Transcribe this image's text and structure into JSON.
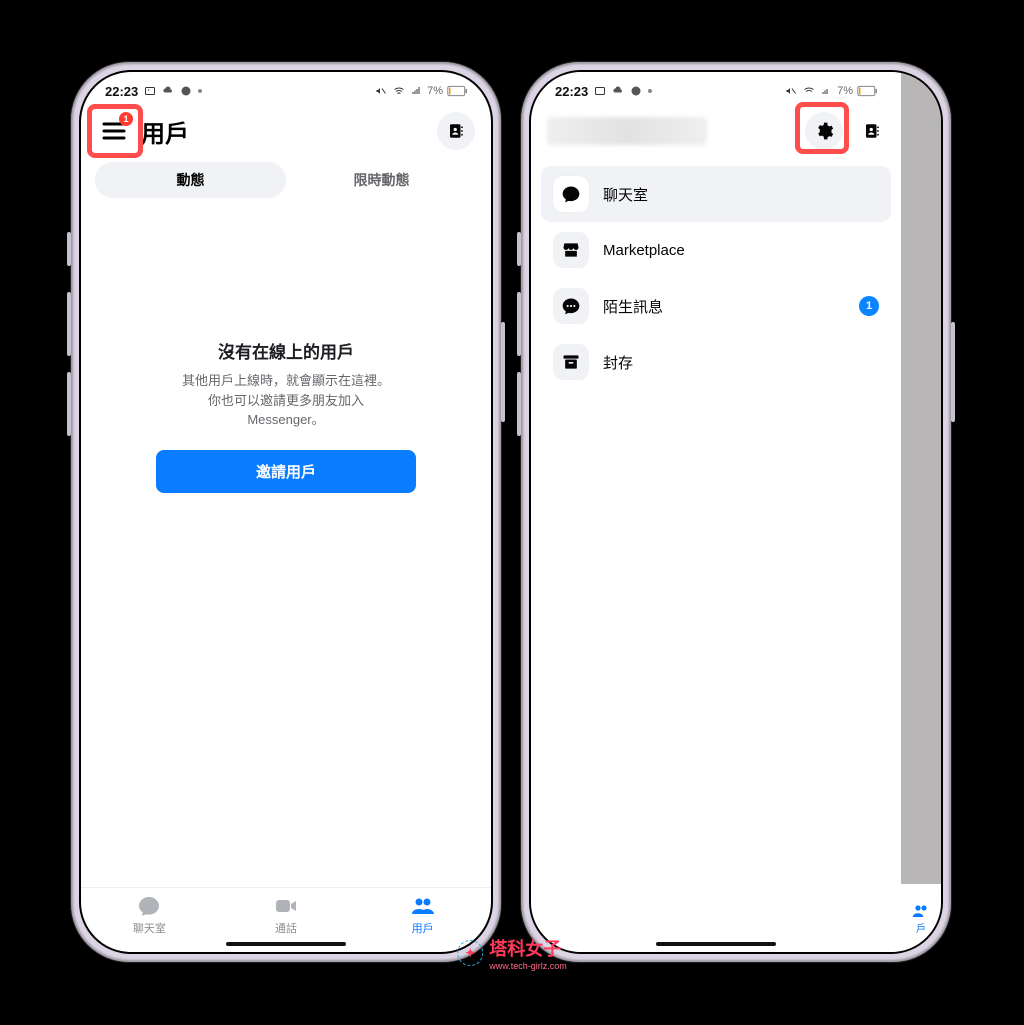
{
  "status": {
    "time": "22:23",
    "battery": "7%"
  },
  "left_phone": {
    "header": {
      "title": "用戶",
      "menu_badge": "1"
    },
    "tabs": {
      "active": "動態",
      "inactive": "限時動態"
    },
    "empty": {
      "title": "沒有在線上的用戶",
      "line1": "其他用戶上線時，就會顯示在這裡。",
      "line2": "你也可以邀請更多朋友加入",
      "line3": "Messenger。",
      "button": "邀請用戶"
    },
    "bottom_nav": {
      "chats": "聊天室",
      "calls": "通話",
      "people": "用戶"
    }
  },
  "right_phone": {
    "drawer": {
      "items": [
        {
          "icon": "chat",
          "label": "聊天室",
          "selected": true
        },
        {
          "icon": "marketplace",
          "label": "Marketplace"
        },
        {
          "icon": "message-requests",
          "label": "陌生訊息",
          "badge": "1"
        },
        {
          "icon": "archive",
          "label": "封存"
        }
      ]
    },
    "bg_tab_short": "戶"
  },
  "watermark": {
    "text": "塔科女子",
    "url": "www.tech-girlz.com"
  }
}
